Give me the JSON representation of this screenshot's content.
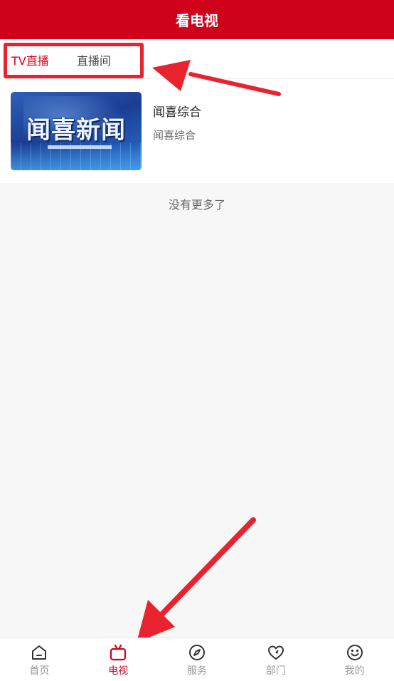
{
  "header": {
    "title": "看电视"
  },
  "tabs": [
    {
      "label": "TV直播",
      "active": true
    },
    {
      "label": "直播间",
      "active": false
    }
  ],
  "channel": {
    "thumbnail_text": "闻喜新闻",
    "title": "闻喜综合",
    "subtitle": "闻喜综合"
  },
  "list_footer": "没有更多了",
  "bottom_nav": [
    {
      "label": "首页",
      "icon": "home-icon",
      "active": false
    },
    {
      "label": "电视",
      "icon": "tv-icon",
      "active": true
    },
    {
      "label": "服务",
      "icon": "compass-icon",
      "active": false
    },
    {
      "label": "部门",
      "icon": "heart-icon",
      "active": false
    },
    {
      "label": "我的",
      "icon": "smiley-icon",
      "active": false
    }
  ],
  "colors": {
    "brand": "#d0021b",
    "annotation": "#e8222e",
    "inactive": "#9a9a9a"
  }
}
